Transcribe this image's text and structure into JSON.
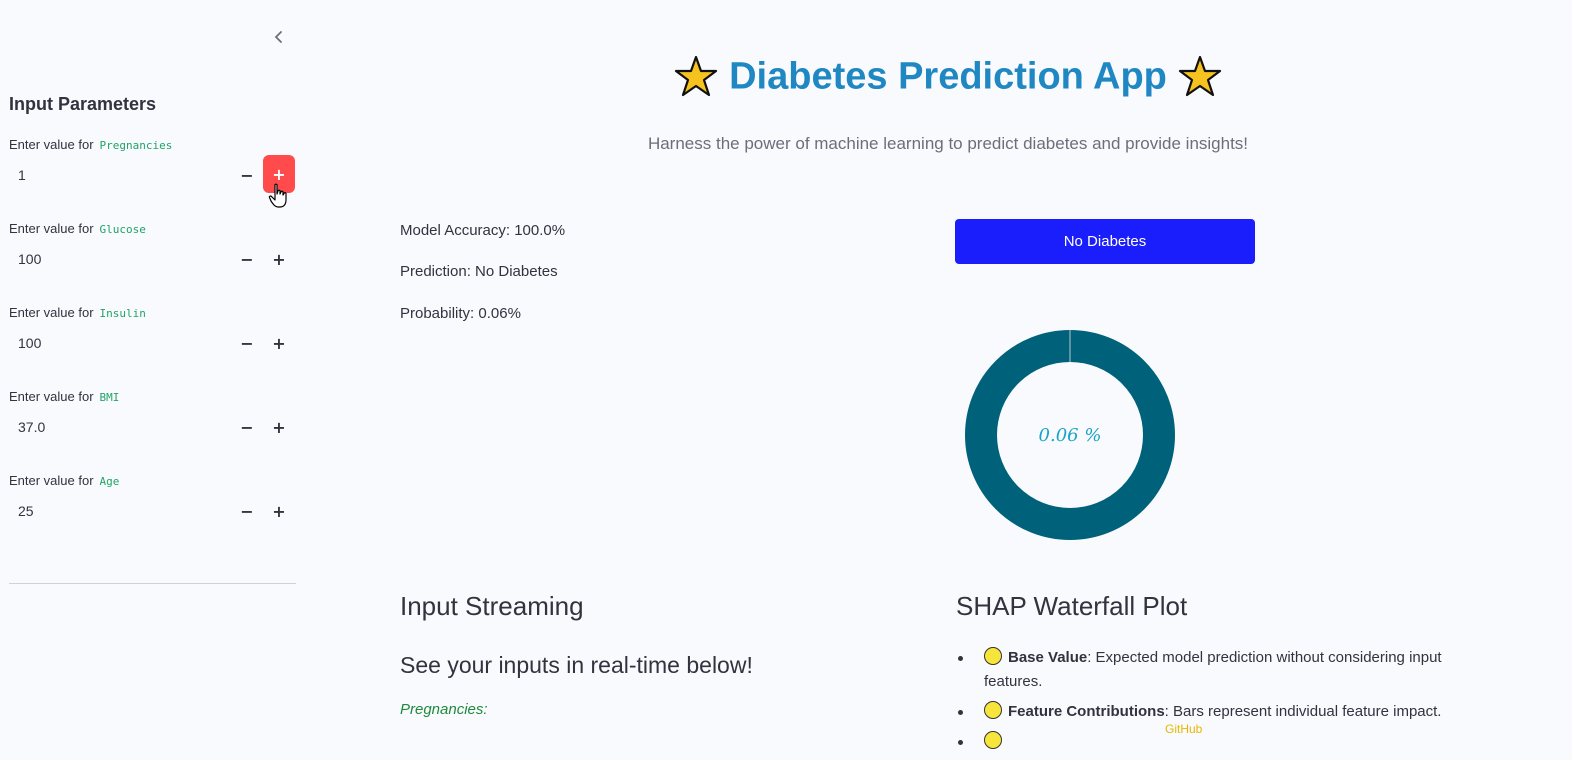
{
  "sidebar": {
    "title": "Input Parameters",
    "label_prefix": "Enter value for",
    "params": [
      {
        "name": "Pregnancies",
        "value": "1"
      },
      {
        "name": "Glucose",
        "value": "100"
      },
      {
        "name": "Insulin",
        "value": "100"
      },
      {
        "name": "BMI",
        "value": "37.0"
      },
      {
        "name": "Age",
        "value": "25"
      }
    ],
    "minus_symbol": "−",
    "plus_symbol": "+",
    "active_color": "#ff4b4b"
  },
  "header": {
    "title": "Diabetes Prediction App",
    "subtitle": "Harness the power of machine learning to predict diabetes and provide insights!"
  },
  "results": {
    "accuracy": "Model Accuracy: 100.0%",
    "prediction": "Prediction: No Diabetes",
    "probability": "Probability: 0.06%",
    "button_label": "No Diabetes",
    "button_color": "#1a1efc",
    "donut_text": "0.06 %",
    "donut_fraction": 0.0006,
    "donut_color": "#00627a"
  },
  "streaming": {
    "heading": "Input Streaming",
    "subheading": "See your inputs in real-time below!",
    "first_label": "Pregnancies:"
  },
  "shap": {
    "heading": "SHAP Waterfall Plot",
    "items": [
      {
        "bold": "Base Value",
        "text": ": Expected model prediction without considering input features."
      },
      {
        "bold": "Feature Contributions",
        "text": ": Bars represent individual feature impact."
      },
      {
        "bold": "",
        "text": ""
      }
    ]
  },
  "footer": {
    "github": "GitHub"
  }
}
